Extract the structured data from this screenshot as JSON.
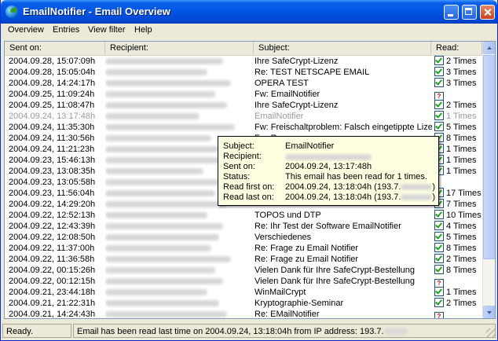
{
  "window": {
    "title": "EmailNotifier - Email Overview"
  },
  "menu": [
    "Overview",
    "Entries",
    "View filter",
    "Help"
  ],
  "columns": {
    "sent": "Sent on:",
    "recipient": "Recipient:",
    "subject": "Subject:",
    "read": "Read:"
  },
  "rows": [
    {
      "sent": "2004.09.28, 15:07:09h",
      "subject": "Ihre SafeCrypt-Lizenz",
      "read": "2 Times",
      "status": "read"
    },
    {
      "sent": "2004.09.28, 15:05:04h",
      "subject": "Re: TEST NETSCAPE EMAIL",
      "read": "3 Times",
      "status": "read"
    },
    {
      "sent": "2004.09.28, 14:24:17h",
      "subject": "OPERA TEST",
      "read": "3 Times",
      "status": "read"
    },
    {
      "sent": "2004.09.25, 11:09:24h",
      "subject": "Fw: EmailNotifier",
      "read": "",
      "status": "unknown"
    },
    {
      "sent": "2004.09.25, 11:08:47h",
      "subject": "Ihre SafeCrypt-Lizenz",
      "read": "2 Times",
      "status": "read"
    },
    {
      "sent": "2004.09.24, 13:17:48h",
      "subject": "EmailNotifier",
      "read": "1 Times",
      "status": "read",
      "dim": true
    },
    {
      "sent": "2004.09.24, 11:35:30h",
      "subject": "Fw: Freischaltproblem: Falsch eingetippte Lizenz",
      "read": "5 Times",
      "status": "read"
    },
    {
      "sent": "2004.09.24, 11:30:56h",
      "subject": "Fw: Re: ...",
      "read": "8 Times",
      "status": "read"
    },
    {
      "sent": "2004.09.24, 11:21:23h",
      "subject": "",
      "read": "1 Times",
      "status": "read"
    },
    {
      "sent": "2004.09.23, 15:46:13h",
      "subject": "",
      "read": "1 Times",
      "status": "read"
    },
    {
      "sent": "2004.09.23, 13:08:35h",
      "subject": "",
      "read": "1 Times",
      "status": "read"
    },
    {
      "sent": "2004.09.23, 13:05:58h",
      "subject": "",
      "read": "",
      "status": "none"
    },
    {
      "sent": "2004.09.23, 11:56:04h",
      "subject": "",
      "read": "17 Times",
      "status": "read"
    },
    {
      "sent": "2004.09.22, 14:29:20h",
      "subject": "",
      "read": "7 Times",
      "status": "read"
    },
    {
      "sent": "2004.09.22, 12:52:13h",
      "subject": "TOPOS und DTP",
      "read": "10 Times",
      "status": "read"
    },
    {
      "sent": "2004.09.22, 12:43:39h",
      "subject": "Re: Ihr Test der Software EmailNotifier",
      "read": "4 Times",
      "status": "read"
    },
    {
      "sent": "2004.09.22, 12:08:50h",
      "subject": "Verschiedenes",
      "read": "5 Times",
      "status": "read"
    },
    {
      "sent": "2004.09.22, 11:37:00h",
      "subject": "Re: Frage zu Email Notifier",
      "read": "8 Times",
      "status": "read"
    },
    {
      "sent": "2004.09.22, 11:36:58h",
      "subject": "Re: Frage zu Email Notifier",
      "read": "2 Times",
      "status": "read"
    },
    {
      "sent": "2004.09.22, 00:15:26h",
      "subject": "Vielen Dank für Ihre SafeCrypt-Bestellung",
      "read": "8 Times",
      "status": "read"
    },
    {
      "sent": "2004.09.22, 00:12:15h",
      "subject": "Vielen Dank für Ihre SafeCrypt-Bestellung",
      "read": "",
      "status": "unknown"
    },
    {
      "sent": "2004.09.21, 23:44:18h",
      "subject": "WinMailCrypt",
      "read": "1 Times",
      "status": "read"
    },
    {
      "sent": "2004.09.21, 21:22:31h",
      "subject": "Kryptographie-Seminar",
      "read": "2 Times",
      "status": "read"
    },
    {
      "sent": "2004.09.21, 14:24:43h",
      "subject": "Re: EMailNotifier",
      "read": "",
      "status": "unknown"
    }
  ],
  "tooltip": {
    "subject_label": "Subject:",
    "subject_value": "EmailNotifier",
    "recipient_label": "Recipient:",
    "sent_label": "Sent on:",
    "sent_value": "2004.09.24, 13:17:48h",
    "status_label": "Status:",
    "status_value": "This email has been read for 1 times.",
    "first_label": "Read first on:",
    "first_value": "2004.09.24, 13:18:04h (193.7.",
    "last_label": "Read last on:",
    "last_value": "2004.09.24, 13:18:04h (193.7."
  },
  "status": {
    "left": "Ready.",
    "right": "Email has been read last time on 2004.09.24, 13:18:04h from IP address: 193.7."
  },
  "colors": {
    "title_blue": "#0055e5",
    "check_green": "#21a121",
    "unknown_red": "#cc0000"
  }
}
